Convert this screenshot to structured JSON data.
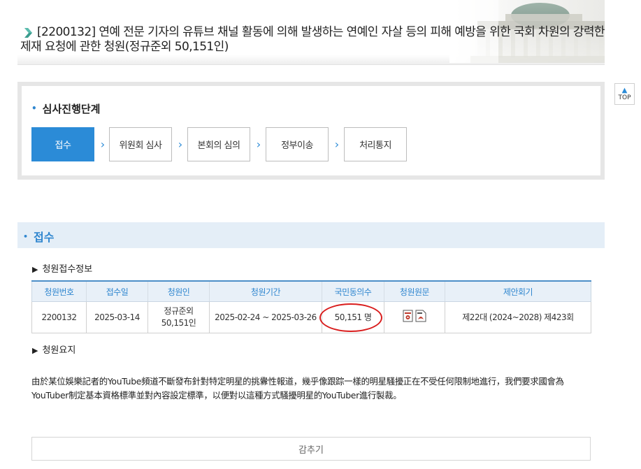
{
  "header": {
    "title": "[2200132] 연예 전문 기자의 유튜브 채널 활동에 의해 발생하는 연예인 자살 등의 피해 예방을 위한 국회 차원의 강력한 제재 요청에 관한 청원(정규준외 50,151인)",
    "title_icon": "chevron-right-icon"
  },
  "top_button": {
    "label": "TOP",
    "icon": "arrow-up-icon"
  },
  "stage": {
    "heading": "심사진행단계",
    "steps": [
      {
        "label": "접수",
        "active": true
      },
      {
        "label": "위원회 심사",
        "active": false
      },
      {
        "label": "본회의 심의",
        "active": false
      },
      {
        "label": "정부이송",
        "active": false
      },
      {
        "label": "처리통지",
        "active": false
      }
    ],
    "accent_color": "#2b8bd7"
  },
  "section": {
    "title": "접수",
    "receipt_info_heading": "청원접수정보",
    "summary_heading": "청원요지"
  },
  "table": {
    "headers": [
      "청원번호",
      "접수일",
      "청원인",
      "청원기간",
      "국민동의수",
      "청원원문",
      "제안회기"
    ],
    "row": {
      "number": "2200132",
      "date": "2025-03-14",
      "petitioner_line1": "정규준외",
      "petitioner_line2": "50,151인",
      "period": "2025-02-24 ~ 2025-03-26",
      "agree_count": "50,151 명",
      "original_icons": [
        "hwp-file-icon",
        "pdf-file-icon"
      ],
      "session": "제22대 (2024~2028) 제423회"
    }
  },
  "summary": {
    "text": "由於某位娛樂記者的YouTube頻道不斷發布針對特定明星的挑釁性報道，幾乎像跟踪一樣的明星騷擾正在不受任何限制地進行，我們要求國會為YouTuber制定基本資格標準並對內容設定標準，以便對以這種方式騷擾明星的YouTuber進行製裁。"
  },
  "collapse_button": {
    "label": "감추기"
  }
}
